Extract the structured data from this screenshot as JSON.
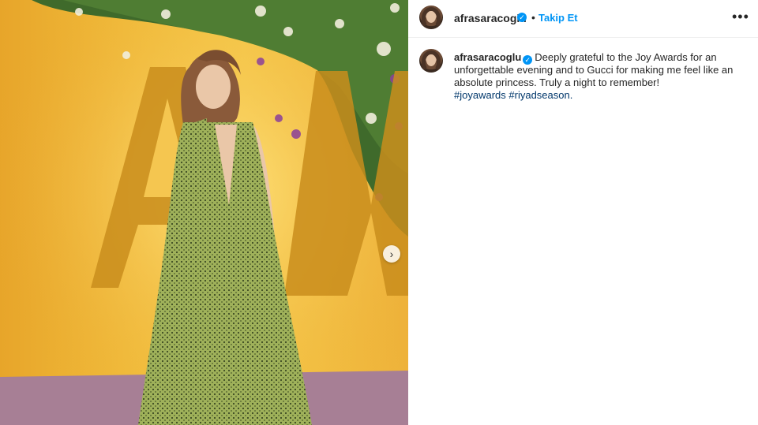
{
  "post": {
    "username": "afrasaracoglu",
    "verified": true,
    "separator": "•",
    "follow_label": "Takip Et",
    "more_icon": "more-horizontal-icon",
    "caption_text": "Deeply grateful to the Joy Awards for an unforgettable evening and to Gucci for making me feel like an absolute princess. Truly a night to remember!",
    "hashtags": [
      "#joyawards",
      "#riyadseason."
    ],
    "next_icon": "chevron-right-icon"
  },
  "colors": {
    "accent": "#0095f6",
    "hashtag": "#00376b",
    "text": "#262626"
  }
}
